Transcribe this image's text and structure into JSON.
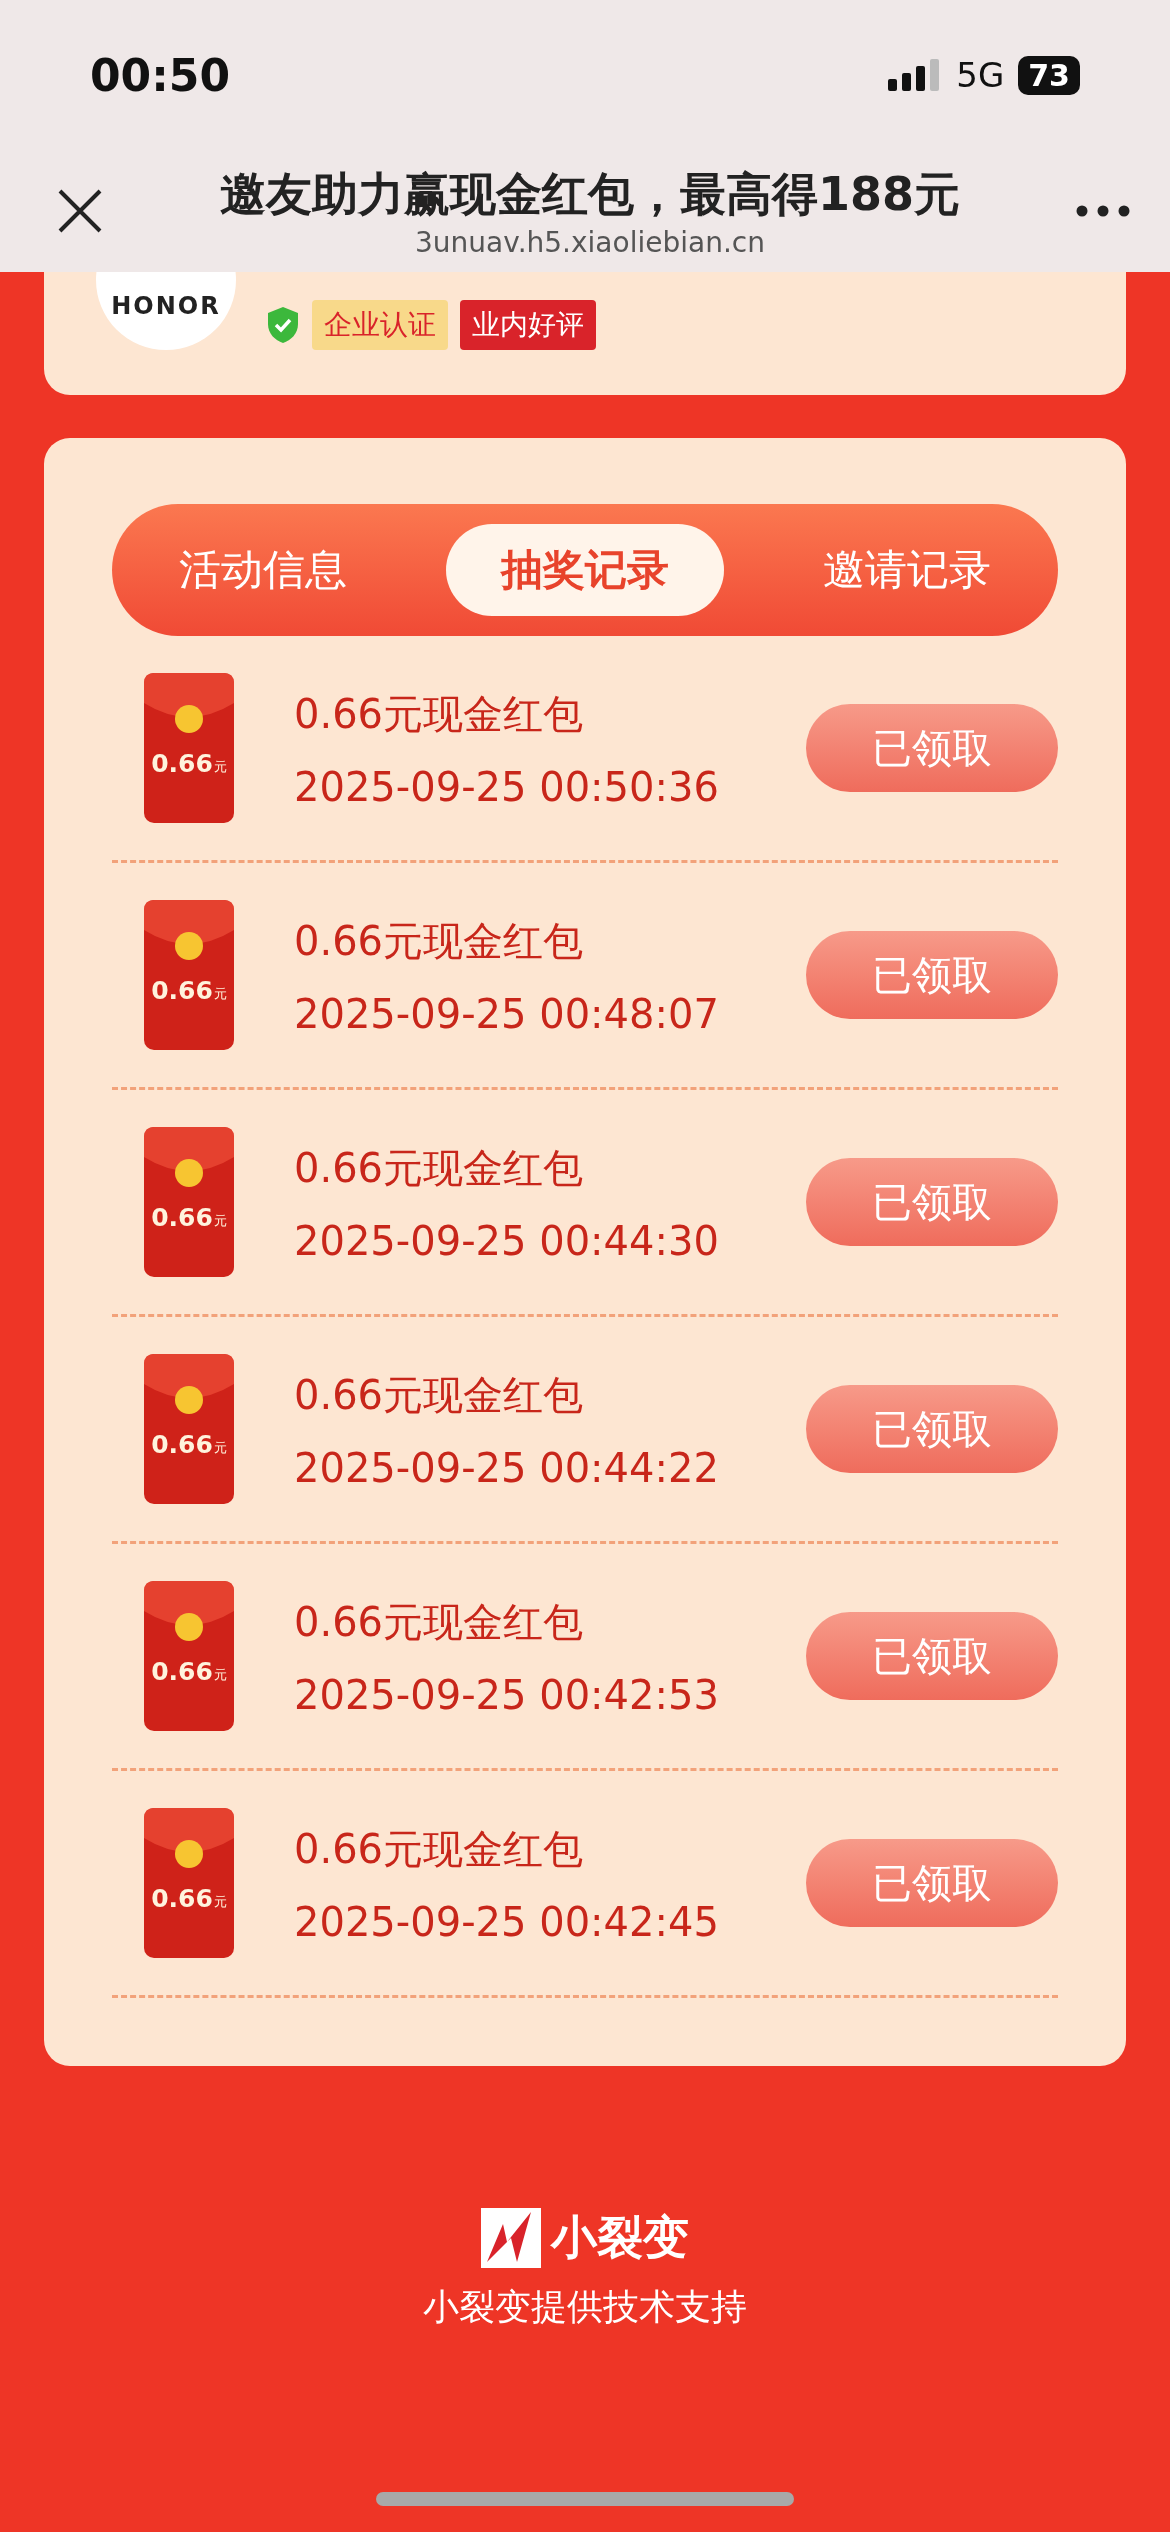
{
  "status_bar": {
    "time": "00:50",
    "network": "5G",
    "battery": "73"
  },
  "browser": {
    "title": "邀友助力赢现金红包，最高得188元",
    "url": "3unuav.h5.xiaoliebian.cn"
  },
  "brand": {
    "logo_text": "HONOR",
    "badges": [
      {
        "label": "企业认证",
        "kind": "verified"
      },
      {
        "label": "业内好评",
        "kind": "praise"
      }
    ]
  },
  "tabs": [
    {
      "label": "活动信息",
      "selected": false
    },
    {
      "label": "抽奖记录",
      "selected": true
    },
    {
      "label": "邀请记录",
      "selected": false
    }
  ],
  "records": [
    {
      "title": "0.66元现金红包",
      "amount": "0.66",
      "unit": "元",
      "time": "2025-09-25 00:50:36",
      "button": "已领取"
    },
    {
      "title": "0.66元现金红包",
      "amount": "0.66",
      "unit": "元",
      "time": "2025-09-25 00:48:07",
      "button": "已领取"
    },
    {
      "title": "0.66元现金红包",
      "amount": "0.66",
      "unit": "元",
      "time": "2025-09-25 00:44:30",
      "button": "已领取"
    },
    {
      "title": "0.66元现金红包",
      "amount": "0.66",
      "unit": "元",
      "time": "2025-09-25 00:44:22",
      "button": "已领取"
    },
    {
      "title": "0.66元现金红包",
      "amount": "0.66",
      "unit": "元",
      "time": "2025-09-25 00:42:53",
      "button": "已领取"
    },
    {
      "title": "0.66元现金红包",
      "amount": "0.66",
      "unit": "元",
      "time": "2025-09-25 00:42:45",
      "button": "已领取"
    }
  ],
  "footer": {
    "brand": "小裂变",
    "text": "小裂变提供技术支持"
  }
}
